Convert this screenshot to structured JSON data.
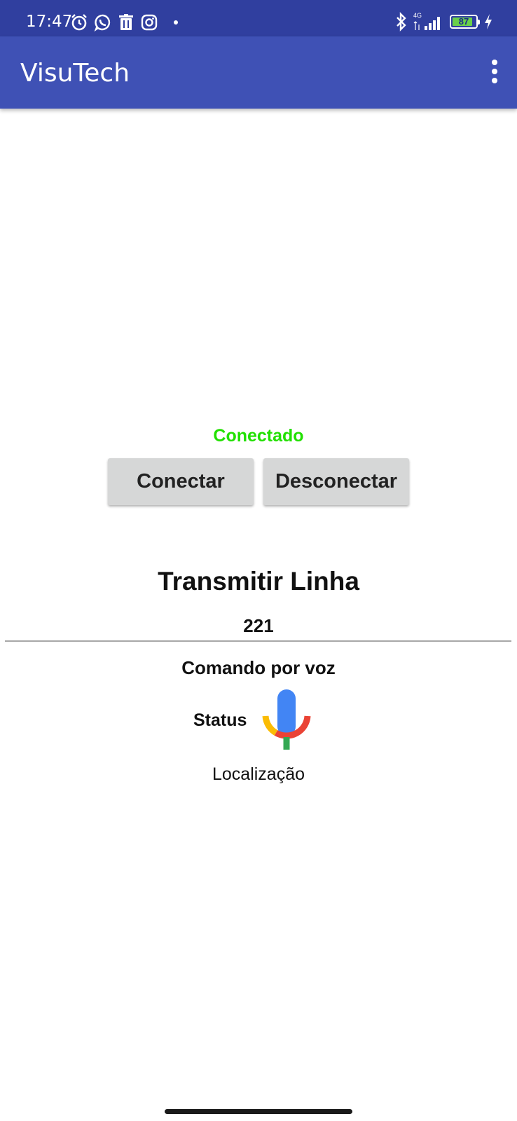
{
  "status_bar": {
    "time": "17:47",
    "network": "4G",
    "battery_level": "87",
    "battery_fraction": 0.87,
    "icons_left": [
      "alarm-icon",
      "whatsapp-icon",
      "trash-icon",
      "instagram-icon",
      "notification-dot-icon"
    ],
    "icons_right": [
      "bluetooth-icon",
      "signal-icon",
      "battery-icon",
      "charging-icon"
    ]
  },
  "app_bar": {
    "title": "VisuTech",
    "menu_icon": "more-vert-icon"
  },
  "connection": {
    "status": "Conectado",
    "status_color": "#22e000",
    "connect_label": "Conectar",
    "disconnect_label": "Desconectar"
  },
  "transmit": {
    "title": "Transmitir Linha",
    "line_number": "221"
  },
  "voice": {
    "label": "Comando por voz",
    "status_label": "Status",
    "mic_icon": "microphone-icon",
    "location_label": "Localização"
  },
  "colors": {
    "status_bar": "#303f9f",
    "app_bar": "#3f51b5",
    "button_bg": "#d6d7d7",
    "mic_blue": "#4285f4",
    "mic_red": "#ea4335",
    "mic_yellow": "#fbbc04",
    "mic_green": "#34a853"
  }
}
